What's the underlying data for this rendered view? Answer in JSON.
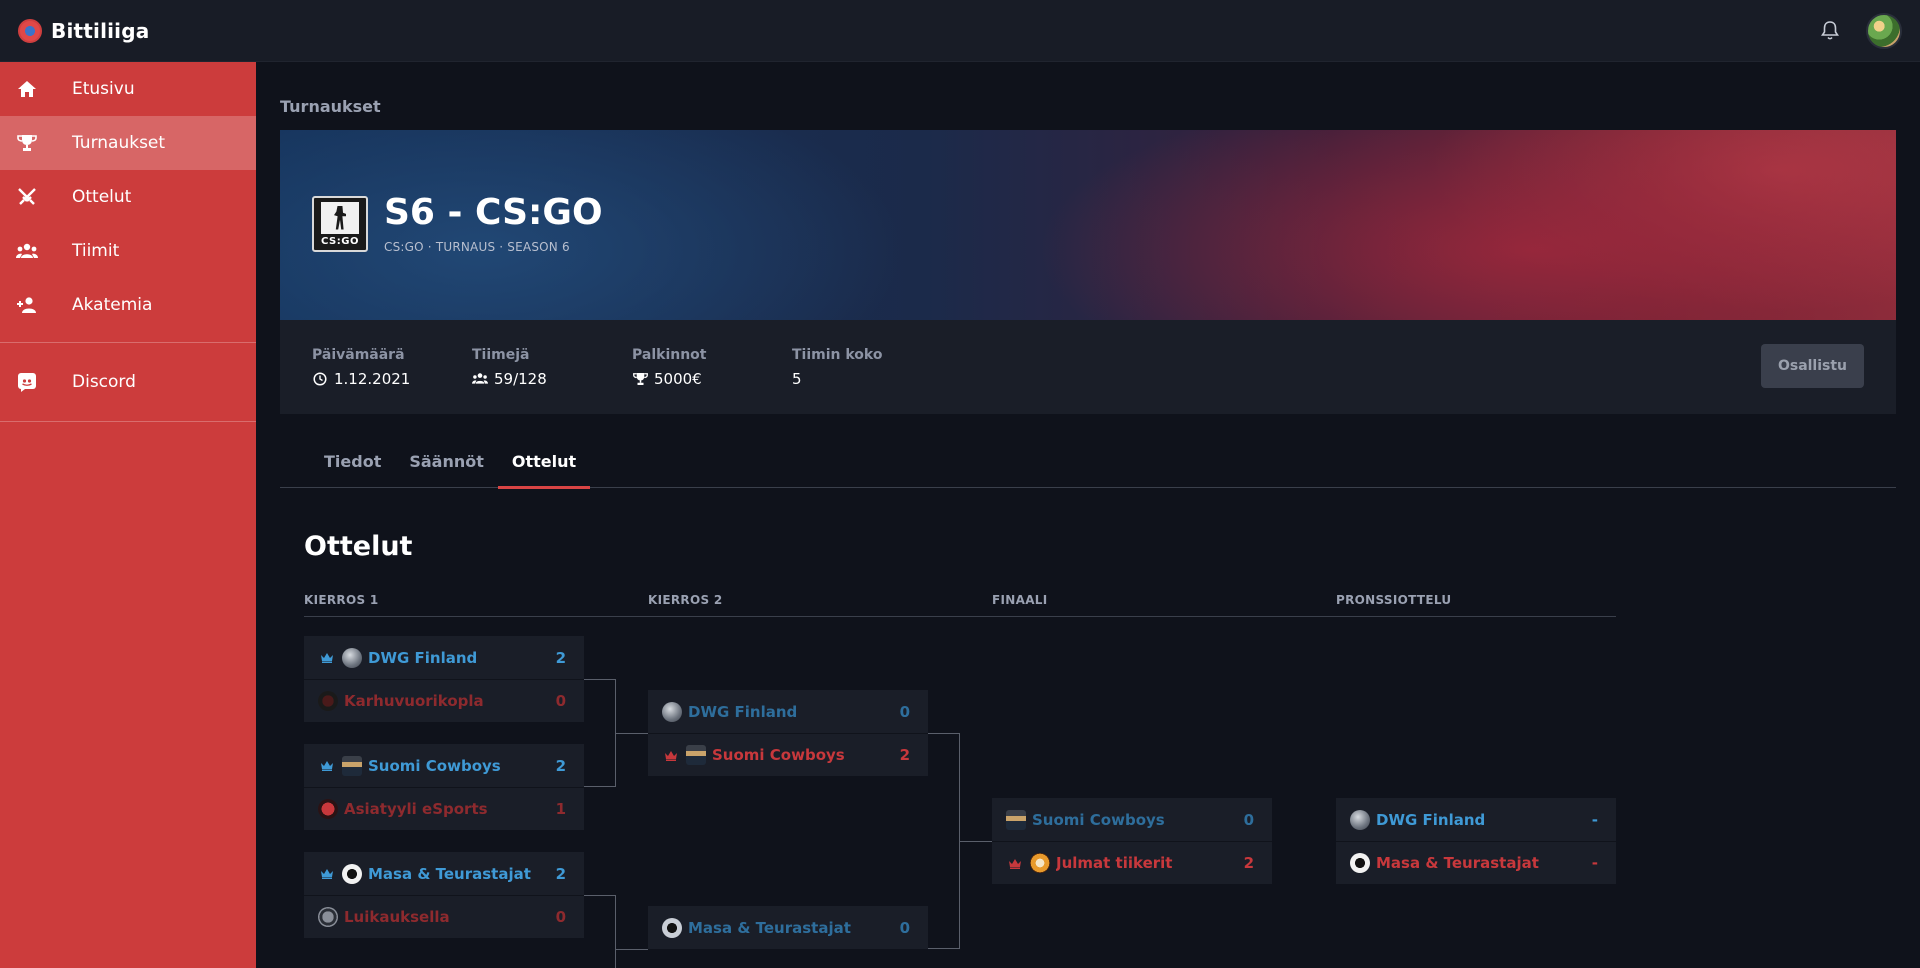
{
  "app": {
    "name": "Bittiliiga"
  },
  "sidebar": {
    "items": [
      {
        "label": "Etusivu",
        "icon": "home-icon"
      },
      {
        "label": "Turnaukset",
        "icon": "trophy-icon",
        "active": true
      },
      {
        "label": "Ottelut",
        "icon": "swords-icon"
      },
      {
        "label": "Tiimit",
        "icon": "group-icon"
      },
      {
        "label": "Akatemia",
        "icon": "add-person-icon"
      }
    ],
    "discord": {
      "label": "Discord",
      "icon": "discord-icon"
    }
  },
  "breadcrumb": "Turnaukset",
  "tournament": {
    "title": "S6 - CS:GO",
    "subtitle": "CS:GO · TURNAUS · SEASON 6",
    "logo_text": "CS:GO"
  },
  "info": {
    "date_label": "Päivämäärä",
    "date_value": "1.12.2021",
    "teams_label": "Tiimejä",
    "teams_value": "59/128",
    "prizes_label": "Palkinnot",
    "prizes_value": "5000€",
    "team_size_label": "Tiimin koko",
    "team_size_value": "5",
    "join_label": "Osallistu"
  },
  "tabs": [
    {
      "label": "Tiedot"
    },
    {
      "label": "Säännöt"
    },
    {
      "label": "Ottelut",
      "active": true
    }
  ],
  "matches_title": "Ottelut",
  "rounds": [
    "KIERROS 1",
    "KIERROS 2",
    "FINAALI",
    "PRONSSIOTTELU"
  ],
  "bracket": {
    "r1m1": [
      {
        "name": "DWG Finland",
        "score": "2"
      },
      {
        "name": "Karhuvuorikopla",
        "score": "0"
      }
    ],
    "r1m2": [
      {
        "name": "Suomi Cowboys",
        "score": "2"
      },
      {
        "name": "Asiatyyli eSports",
        "score": "1"
      }
    ],
    "r1m3": [
      {
        "name": "Masa & Teurastajat",
        "score": "2"
      },
      {
        "name": "Luikauksella",
        "score": "0"
      }
    ],
    "r2m1": [
      {
        "name": "DWG Finland",
        "score": "0"
      },
      {
        "name": "Suomi Cowboys",
        "score": "2"
      }
    ],
    "r2m2": [
      {
        "name": "Masa & Teurastajat",
        "score": "0"
      }
    ],
    "final": [
      {
        "name": "Suomi Cowboys",
        "score": "0"
      },
      {
        "name": "Julmat tiikerit",
        "score": "2"
      }
    ],
    "bronze": [
      {
        "name": "DWG Finland",
        "score": "-"
      },
      {
        "name": "Masa & Teurastajat",
        "score": "-"
      }
    ]
  },
  "colors": {
    "sidebar": "#cc3c3c",
    "win": "#3f9ad6",
    "lose": "#c8383c",
    "accent": "#d94444"
  }
}
